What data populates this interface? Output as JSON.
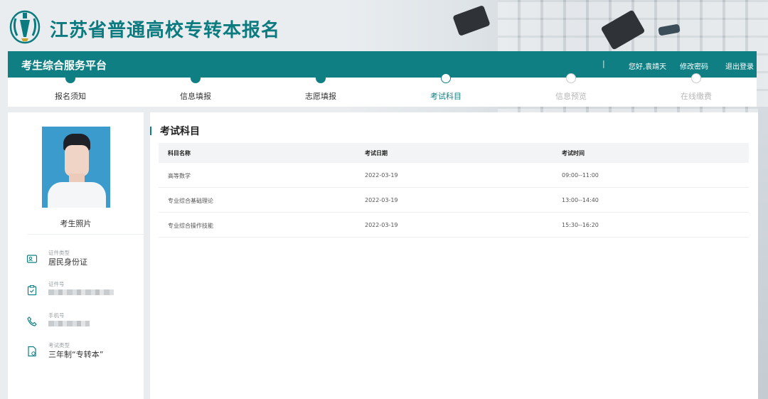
{
  "header": {
    "site_title": "江苏省普通高校专转本报名"
  },
  "navbar": {
    "platform_name": "考生综合服务平台",
    "separator": "|",
    "greeting": "您好,袁靖天",
    "change_password": "修改密码",
    "logout": "退出登录"
  },
  "steps": [
    {
      "label": "报名须知",
      "state": "done"
    },
    {
      "label": "信息填报",
      "state": "done"
    },
    {
      "label": "志愿填报",
      "state": "done"
    },
    {
      "label": "考试科目",
      "state": "current"
    },
    {
      "label": "信息预览",
      "state": "todo"
    },
    {
      "label": "在线缴费",
      "state": "todo"
    }
  ],
  "profile": {
    "photo_caption": "考生照片",
    "id_type_label": "证件类型",
    "id_type_value": "居民身份证",
    "id_number_label": "证件号",
    "phone_label": "手机号",
    "exam_type_label": "考试类型",
    "exam_type_value": "三年制“专转本”"
  },
  "main": {
    "section_title": "考试科目",
    "columns": [
      "科目名称",
      "考试日期",
      "考试时间"
    ],
    "rows": [
      [
        "高等数学",
        "2022-03-19",
        "09:00--11:00"
      ],
      [
        "专业综合基础理论",
        "2022-03-19",
        "13:00--14:40"
      ],
      [
        "专业综合操作技能",
        "2022-03-19",
        "15:30--16:20"
      ]
    ]
  },
  "colors": {
    "brand": "#0f7f83",
    "title": "#0b7b80"
  },
  "icons": [
    "logo-emblem-icon",
    "id-card-icon",
    "clipboard-icon",
    "phone-icon",
    "exam-doc-icon"
  ]
}
